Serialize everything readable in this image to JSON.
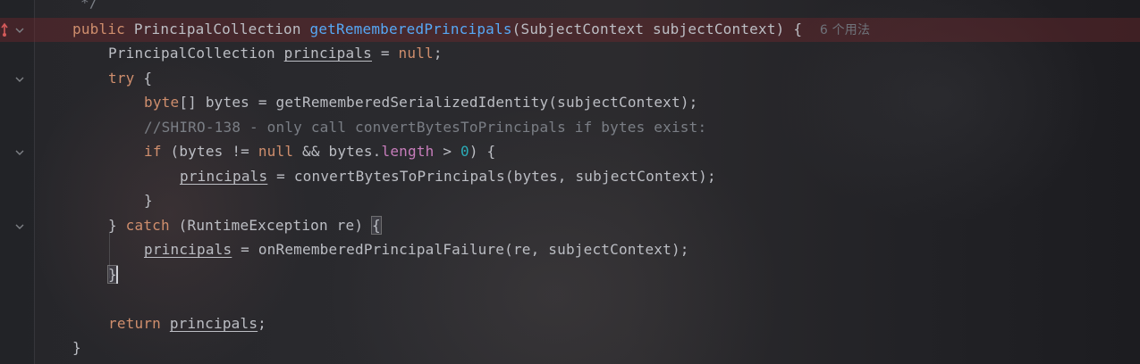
{
  "editor": {
    "lines": [
      {
        "comment": "*/"
      },
      {
        "kw1": "public",
        "type": "PrincipalCollection",
        "method": "getRememberedPrincipals",
        "params": "(SubjectContext subjectContext) {",
        "hint": "6 个用法"
      },
      {
        "type": "PrincipalCollection",
        "var": "principals",
        "eq": "=",
        "kw": "null",
        "end": ";"
      },
      {
        "kw": "try",
        "rest": "{"
      },
      {
        "kw": "byte",
        "rest": "[] bytes = getRememberedSerializedIdentity(subjectContext);"
      },
      {
        "comment": "//SHIRO-138 - only call convertBytesToPrincipals if bytes exist:"
      },
      {
        "kw": "if",
        "a": "(bytes != ",
        "kw2": "null",
        "b": " && bytes.",
        "field": "length",
        "c": " > ",
        "num": "0",
        "d": ") {"
      },
      {
        "var": "principals",
        "rest": " = convertBytesToPrincipals(bytes, subjectContext);"
      },
      {
        "rest": "}"
      },
      {
        "pre": "} ",
        "kw": "catch",
        "rest": " (RuntimeException re) ",
        "brace": "{"
      },
      {
        "var": "principals",
        "rest": " = onRememberedPrincipalFailure(re, subjectContext);"
      },
      {
        "brace": "}"
      },
      {
        "kw": "return",
        "var": "principals",
        "end": ";"
      },
      {
        "rest": "}"
      }
    ]
  },
  "colors": {
    "keyword": "#cf8e6d",
    "method": "#56a8f5",
    "comment": "#7a7e85",
    "field": "#c77dbb",
    "number": "#2aacb8",
    "text": "#bcbec4",
    "highlight_row": "#782e35"
  },
  "gutter_icons": [
    "breakpoint-arrow-icon",
    "fold-arrow-icon"
  ]
}
